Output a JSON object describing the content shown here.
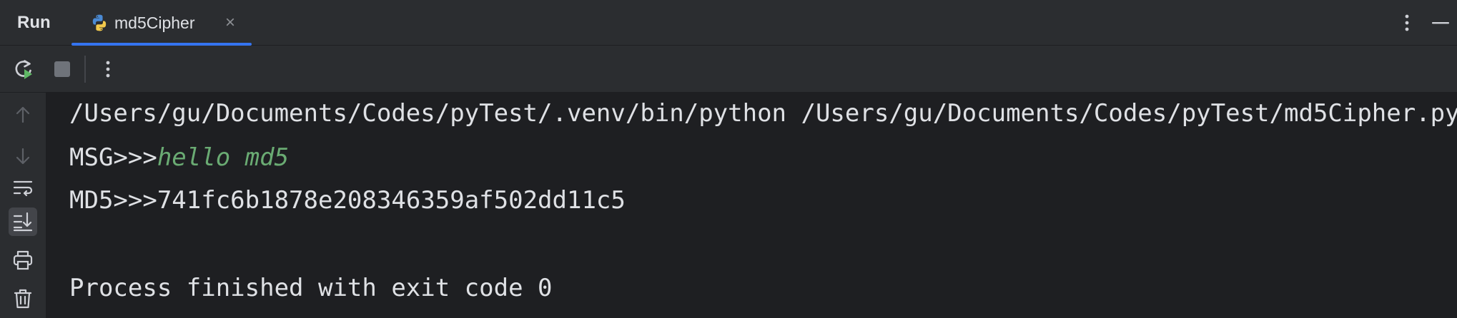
{
  "toolwindow": {
    "title": "Run",
    "tab": {
      "label": "md5Cipher",
      "close_glyph": "×",
      "icon": "python-icon"
    }
  },
  "toolbar": {
    "buttons": [
      {
        "name": "rerun-icon"
      },
      {
        "name": "stop-icon"
      },
      {
        "name": "more-vertical-icon"
      }
    ]
  },
  "gutter": {
    "buttons": [
      {
        "name": "arrow-up-icon"
      },
      {
        "name": "arrow-down-icon"
      },
      {
        "name": "soft-wrap-icon"
      },
      {
        "name": "scroll-to-end-icon",
        "active": true
      },
      {
        "name": "print-icon"
      },
      {
        "name": "trash-icon"
      }
    ]
  },
  "console": {
    "command": "/Users/gu/Documents/Codes/pyTest/.venv/bin/python /Users/gu/Documents/Codes/pyTest/md5Cipher.py",
    "msg_prompt": "MSG>>>",
    "msg_input": "hello md5",
    "md5_prompt": "MD5>>>",
    "md5_value": "741fc6b1878e208346359af502dd11c5",
    "exit_message": "Process finished with exit code 0"
  },
  "colors": {
    "accent": "#3574f0",
    "user_input": "#6aab73",
    "rerun_green": "#5fb865"
  }
}
